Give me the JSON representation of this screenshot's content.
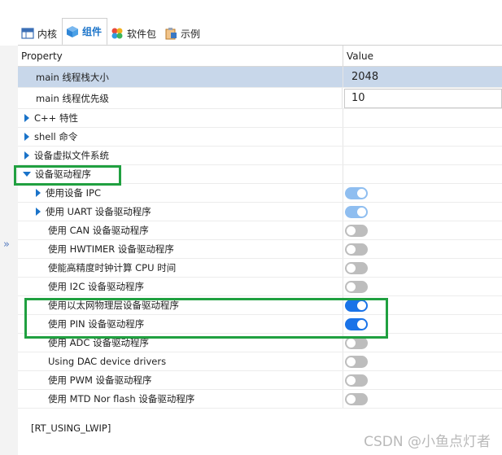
{
  "tabs": [
    {
      "label": "内核",
      "icon": "kernel-grid-icon",
      "active": false
    },
    {
      "label": "组件",
      "icon": "component-cube-icon",
      "active": true
    },
    {
      "label": "软件包",
      "icon": "package-icon",
      "active": false
    },
    {
      "label": "示例",
      "icon": "example-clipboard-icon",
      "active": false
    }
  ],
  "table": {
    "col_property": "Property",
    "col_value": "Value",
    "rows": [
      {
        "label": "main 线程栈大小",
        "value": "2048"
      },
      {
        "label": "main 线程优先级",
        "value": "10"
      },
      {
        "label": "C++ 特性"
      },
      {
        "label": "shell 命令"
      },
      {
        "label": "设备虚拟文件系统"
      },
      {
        "label": "设备驱动程序"
      },
      {
        "label": "使用设备 IPC"
      },
      {
        "label": "使用 UART 设备驱动程序"
      },
      {
        "label": "使用 CAN 设备驱动程序"
      },
      {
        "label": "使用 HWTIMER 设备驱动程序"
      },
      {
        "label": "使能高精度时钟计算 CPU 时间"
      },
      {
        "label": "使用 I2C 设备驱动程序"
      },
      {
        "label": "使用以太网物理层设备驱动程序"
      },
      {
        "label": "使用 PIN 设备驱动程序"
      },
      {
        "label": "使用 ADC 设备驱动程序"
      },
      {
        "label": "Using DAC device drivers"
      },
      {
        "label": "使用 PWM 设备驱动程序"
      },
      {
        "label": "使用 MTD Nor flash 设备驱动程序"
      }
    ]
  },
  "toggles": {
    "ipc": "on-disabled",
    "uart": "on-disabled",
    "can": "off",
    "hwtimer": "off",
    "cputime": "off",
    "i2c": "off",
    "phy": "on",
    "pin": "on",
    "adc": "off",
    "dac": "off",
    "pwm": "off",
    "mtd": "off"
  },
  "footer": "[RT_USING_LWIP]",
  "watermark": "CSDN @小鱼点灯者",
  "colors": {
    "accent": "#1a73e8",
    "highlight": "#20a040",
    "selected_row": "#c8d7ea"
  }
}
